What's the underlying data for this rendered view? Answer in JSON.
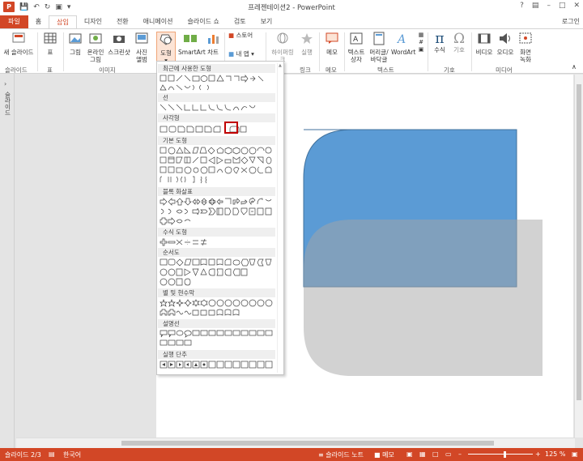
{
  "window": {
    "title": "프레젠테이션2 - PowerPoint",
    "login": "로그인"
  },
  "tabs": [
    {
      "label": "파일"
    },
    {
      "label": "홈"
    },
    {
      "label": "삽입"
    },
    {
      "label": "디자인"
    },
    {
      "label": "전환"
    },
    {
      "label": "애니메이션"
    },
    {
      "label": "슬라이드 쇼"
    },
    {
      "label": "검토"
    },
    {
      "label": "보기"
    }
  ],
  "ribbon": {
    "new_slide": "새 슬라이드",
    "table": "표",
    "picture": "그림",
    "online_picture_1": "온라인",
    "online_picture_2": "그림",
    "screenshot": "스크린샷",
    "album_1": "사진",
    "album_2": "앨범",
    "shapes": "도형",
    "smartart": "SmartArt",
    "chart": "차트",
    "store": "스토어",
    "my_apps": "내 앱",
    "hyperlink": "하이퍼링크",
    "action": "실행",
    "comment": "메모",
    "textbox_1": "텍스트",
    "textbox_2": "상자",
    "header_1": "머리글/",
    "header_2": "바닥글",
    "wordart": "WordArt",
    "equation": "수식",
    "symbol": "기호",
    "video": "비디오",
    "audio": "오디오",
    "screenrec_1": "화면",
    "screenrec_2": "녹화",
    "groups": {
      "slides": "슬라이드",
      "tables": "표",
      "images": "이미지",
      "links": "링크",
      "comments": "메모",
      "text": "텍스트",
      "symbols": "기호",
      "media": "미디어"
    }
  },
  "leftpane": {
    "label": "슬라이드"
  },
  "shapes_menu": {
    "sections": [
      {
        "label": "최근에 사용한 도형"
      },
      {
        "label": "선"
      },
      {
        "label": "사각형"
      },
      {
        "label": "기본 도형"
      },
      {
        "label": "블록 화살표"
      },
      {
        "label": "수식 도형"
      },
      {
        "label": "순서도"
      },
      {
        "label": "별 및 현수막"
      },
      {
        "label": "설명선"
      },
      {
        "label": "실행 단추"
      }
    ]
  },
  "status": {
    "slide": "슬라이드 2/3",
    "language": "한국어",
    "notes": "슬라이드 노트",
    "comments": "메모",
    "zoom": "125 %"
  },
  "colors": {
    "accent": "#d24726",
    "shape_blue": "#5b9bd5",
    "shape_gray": "#a6a6a6"
  }
}
